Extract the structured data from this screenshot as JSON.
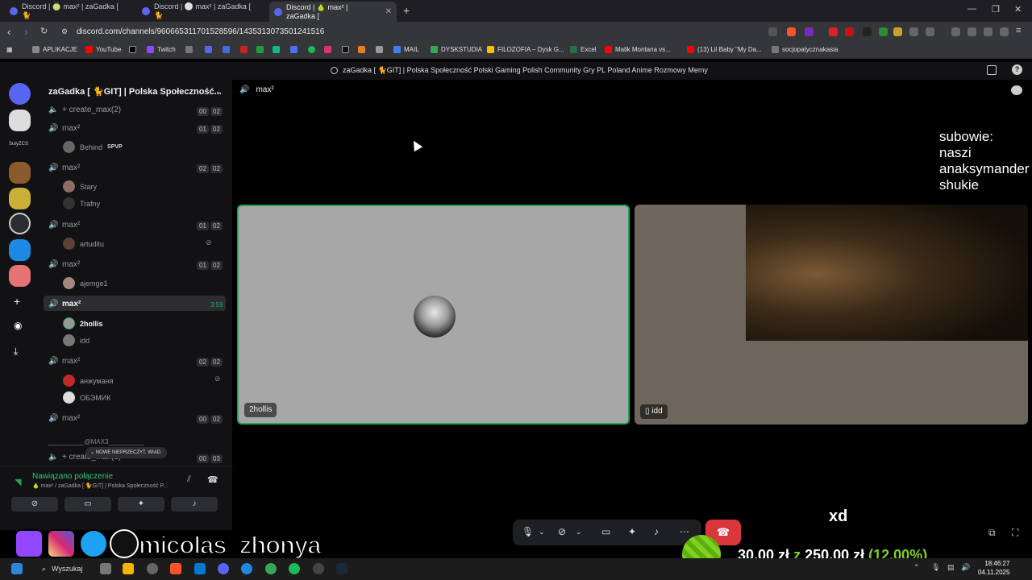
{
  "browser": {
    "tabs": [
      {
        "label": "Discord | 🍈 max² | zaGadka [ 🐈"
      },
      {
        "label": "Discord | ⚪ max² | zaGadka [ 🐈"
      },
      {
        "label": "Discord | 🍐 max² | zaGadka ["
      }
    ],
    "url": "discord.com/channels/960665311701528596/1435313073501241516",
    "bookmarks": [
      "APLIKACJE",
      "YouTube",
      "Twitch",
      "MAIL",
      "DYSKSTUDIA",
      "FILOZOFIA – Dysk G...",
      "Excel",
      "Malik Montana vs...",
      "(13) Lil Baby \"My Da...",
      "socjopatycznakasia"
    ]
  },
  "discord": {
    "top_bar_title": "zaGadka [ 🐈GIT] | Polska Społeczność Polski Gaming Polish Community Gry PL Poland Anime Rozmowy Memy",
    "server_name": "zaGadka [ 🐈GIT] | Polska Społeczność...",
    "server_label_small": "SutyZCS",
    "channel_header": "max²",
    "channels": [
      {
        "name": "+ create_max(2)",
        "count": "00",
        "limit": "02",
        "users": []
      },
      {
        "name": "max²",
        "count": "01",
        "limit": "02",
        "users": [
          {
            "name": "Behind",
            "tag": "SPVP"
          }
        ]
      },
      {
        "name": "max²",
        "count": "02",
        "limit": "02",
        "users": [
          {
            "name": "Stary",
            "tag": ""
          },
          {
            "name": "Trafny",
            "tag": ""
          }
        ]
      },
      {
        "name": "max²",
        "count": "01",
        "limit": "02",
        "users": [
          {
            "name": "artuditu",
            "tag": ""
          }
        ]
      },
      {
        "name": "max²",
        "count": "01",
        "limit": "02",
        "users": [
          {
            "name": "ajemge1",
            "tag": ""
          }
        ]
      },
      {
        "name": "max²",
        "time": "3:59",
        "users": [
          {
            "name": "2hollis",
            "tag": ""
          },
          {
            "name": "idd",
            "tag": ""
          }
        ]
      },
      {
        "name": "max²",
        "count": "02",
        "limit": "02",
        "users": [
          {
            "name": "анжуманя",
            "tag": ""
          },
          {
            "name": "ОБЭМИК",
            "tag": ""
          }
        ]
      },
      {
        "name": "max²",
        "count": "00",
        "limit": "02",
        "users": []
      }
    ],
    "section_label": "__________@MAX3__________",
    "create_channel_2": "+ create_max(3)",
    "create_channel_2_count": "00",
    "create_channel_2_limit": "03",
    "new_messages_pill": "NOWE NIEPRZECZYT. WIAD.",
    "voice_status": "Nawiązano połączenie",
    "voice_channel": "🍐 max² / zaGadka [ 🐈GIT] | Polska Społeczność P...",
    "tiles": [
      {
        "label": "2hollis"
      },
      {
        "label": "idd"
      }
    ]
  },
  "overlay": {
    "subs_title": "subowie:",
    "subs": [
      "naszi",
      "anaksymander",
      "shukie"
    ],
    "chat_text": "xd",
    "goal_current": "30,00 zł",
    "goal_sep": "z",
    "goal_total": "250,00 zł",
    "goal_pct": "(12.00%)",
    "handle": "micolas_zhonya"
  },
  "taskbar": {
    "search": "Wyszukaj",
    "time": "18:46:27",
    "date": "04.11.2025"
  }
}
